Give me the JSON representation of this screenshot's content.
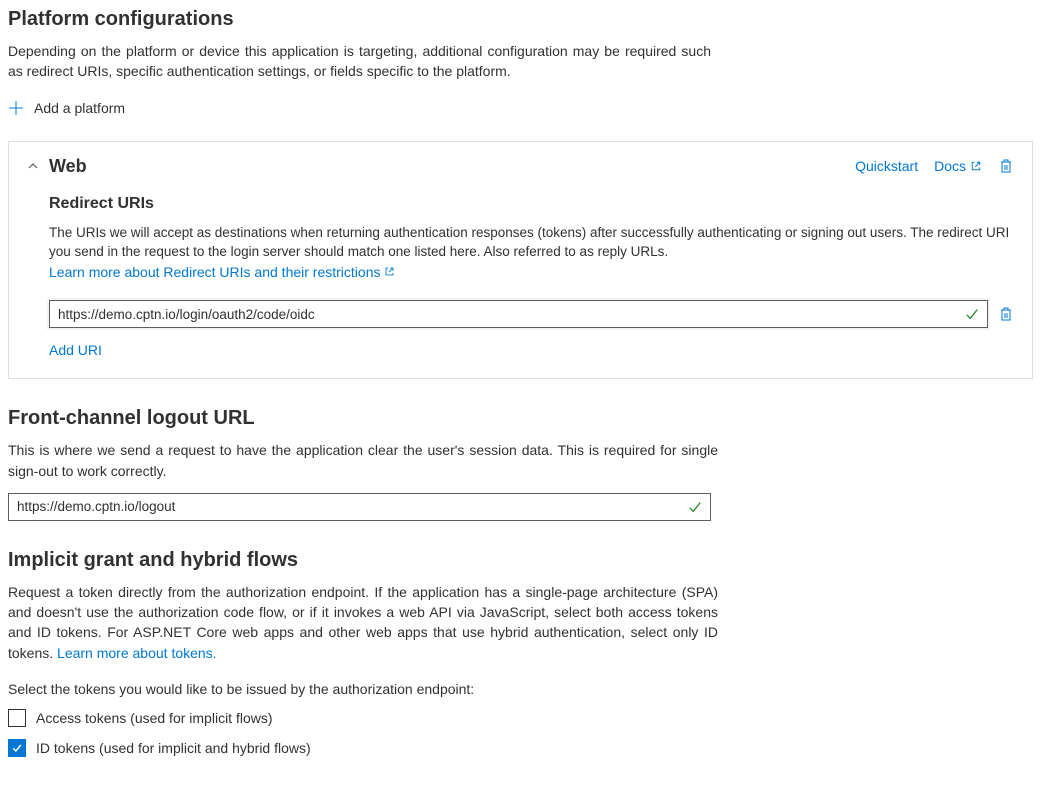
{
  "platform_config": {
    "title": "Platform configurations",
    "desc": "Depending on the platform or device this application is targeting, additional configuration may be required such as redirect URIs, specific authentication settings, or fields specific to the platform.",
    "add_platform_label": "Add a platform"
  },
  "web_card": {
    "title": "Web",
    "quickstart_label": "Quickstart",
    "docs_label": "Docs",
    "redirect_uris": {
      "title": "Redirect URIs",
      "desc_prefix": "The URIs we will accept as destinations when returning authentication responses (tokens) after successfully authenticating or signing out users. The redirect URI you send in the request to the login server should match one listed here. Also referred to as reply URLs. ",
      "learn_more": "Learn more about Redirect URIs and their restrictions",
      "uri_value": "https://demo.cptn.io/login/oauth2/code/oidc",
      "add_uri_label": "Add URI"
    }
  },
  "front_channel": {
    "title": "Front-channel logout URL",
    "desc": "This is where we send a request to have the application clear the user's session data. This is required for single sign-out to work correctly.",
    "value": "https://demo.cptn.io/logout"
  },
  "implicit": {
    "title": "Implicit grant and hybrid flows",
    "desc_prefix": "Request a token directly from the authorization endpoint. If the application has a single-page architecture (SPA) and doesn't use the authorization code flow, or if it invokes a web API via JavaScript, select both access tokens and ID tokens. For ASP.NET Core web apps and other web apps that use hybrid authentication, select only ID tokens. ",
    "learn_more": "Learn more about tokens.",
    "select_label": "Select the tokens you would like to be issued by the authorization endpoint:",
    "access_tokens_label": "Access tokens (used for implicit flows)",
    "access_tokens_checked": false,
    "id_tokens_label": "ID tokens (used for implicit and hybrid flows)",
    "id_tokens_checked": true
  }
}
